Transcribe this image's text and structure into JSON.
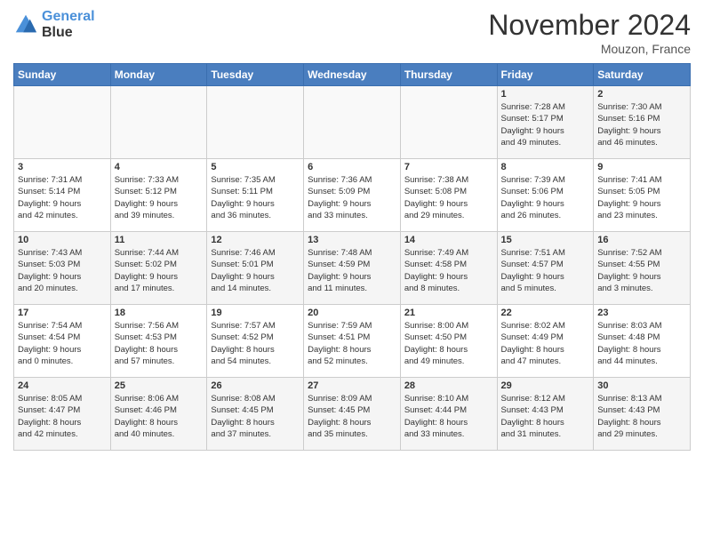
{
  "logo": {
    "line1": "General",
    "line2": "Blue"
  },
  "title": "November 2024",
  "location": "Mouzon, France",
  "days_header": [
    "Sunday",
    "Monday",
    "Tuesday",
    "Wednesday",
    "Thursday",
    "Friday",
    "Saturday"
  ],
  "weeks": [
    [
      {
        "day": "",
        "info": ""
      },
      {
        "day": "",
        "info": ""
      },
      {
        "day": "",
        "info": ""
      },
      {
        "day": "",
        "info": ""
      },
      {
        "day": "",
        "info": ""
      },
      {
        "day": "1",
        "info": "Sunrise: 7:28 AM\nSunset: 5:17 PM\nDaylight: 9 hours\nand 49 minutes."
      },
      {
        "day": "2",
        "info": "Sunrise: 7:30 AM\nSunset: 5:16 PM\nDaylight: 9 hours\nand 46 minutes."
      }
    ],
    [
      {
        "day": "3",
        "info": "Sunrise: 7:31 AM\nSunset: 5:14 PM\nDaylight: 9 hours\nand 42 minutes."
      },
      {
        "day": "4",
        "info": "Sunrise: 7:33 AM\nSunset: 5:12 PM\nDaylight: 9 hours\nand 39 minutes."
      },
      {
        "day": "5",
        "info": "Sunrise: 7:35 AM\nSunset: 5:11 PM\nDaylight: 9 hours\nand 36 minutes."
      },
      {
        "day": "6",
        "info": "Sunrise: 7:36 AM\nSunset: 5:09 PM\nDaylight: 9 hours\nand 33 minutes."
      },
      {
        "day": "7",
        "info": "Sunrise: 7:38 AM\nSunset: 5:08 PM\nDaylight: 9 hours\nand 29 minutes."
      },
      {
        "day": "8",
        "info": "Sunrise: 7:39 AM\nSunset: 5:06 PM\nDaylight: 9 hours\nand 26 minutes."
      },
      {
        "day": "9",
        "info": "Sunrise: 7:41 AM\nSunset: 5:05 PM\nDaylight: 9 hours\nand 23 minutes."
      }
    ],
    [
      {
        "day": "10",
        "info": "Sunrise: 7:43 AM\nSunset: 5:03 PM\nDaylight: 9 hours\nand 20 minutes."
      },
      {
        "day": "11",
        "info": "Sunrise: 7:44 AM\nSunset: 5:02 PM\nDaylight: 9 hours\nand 17 minutes."
      },
      {
        "day": "12",
        "info": "Sunrise: 7:46 AM\nSunset: 5:01 PM\nDaylight: 9 hours\nand 14 minutes."
      },
      {
        "day": "13",
        "info": "Sunrise: 7:48 AM\nSunset: 4:59 PM\nDaylight: 9 hours\nand 11 minutes."
      },
      {
        "day": "14",
        "info": "Sunrise: 7:49 AM\nSunset: 4:58 PM\nDaylight: 9 hours\nand 8 minutes."
      },
      {
        "day": "15",
        "info": "Sunrise: 7:51 AM\nSunset: 4:57 PM\nDaylight: 9 hours\nand 5 minutes."
      },
      {
        "day": "16",
        "info": "Sunrise: 7:52 AM\nSunset: 4:55 PM\nDaylight: 9 hours\nand 3 minutes."
      }
    ],
    [
      {
        "day": "17",
        "info": "Sunrise: 7:54 AM\nSunset: 4:54 PM\nDaylight: 9 hours\nand 0 minutes."
      },
      {
        "day": "18",
        "info": "Sunrise: 7:56 AM\nSunset: 4:53 PM\nDaylight: 8 hours\nand 57 minutes."
      },
      {
        "day": "19",
        "info": "Sunrise: 7:57 AM\nSunset: 4:52 PM\nDaylight: 8 hours\nand 54 minutes."
      },
      {
        "day": "20",
        "info": "Sunrise: 7:59 AM\nSunset: 4:51 PM\nDaylight: 8 hours\nand 52 minutes."
      },
      {
        "day": "21",
        "info": "Sunrise: 8:00 AM\nSunset: 4:50 PM\nDaylight: 8 hours\nand 49 minutes."
      },
      {
        "day": "22",
        "info": "Sunrise: 8:02 AM\nSunset: 4:49 PM\nDaylight: 8 hours\nand 47 minutes."
      },
      {
        "day": "23",
        "info": "Sunrise: 8:03 AM\nSunset: 4:48 PM\nDaylight: 8 hours\nand 44 minutes."
      }
    ],
    [
      {
        "day": "24",
        "info": "Sunrise: 8:05 AM\nSunset: 4:47 PM\nDaylight: 8 hours\nand 42 minutes."
      },
      {
        "day": "25",
        "info": "Sunrise: 8:06 AM\nSunset: 4:46 PM\nDaylight: 8 hours\nand 40 minutes."
      },
      {
        "day": "26",
        "info": "Sunrise: 8:08 AM\nSunset: 4:45 PM\nDaylight: 8 hours\nand 37 minutes."
      },
      {
        "day": "27",
        "info": "Sunrise: 8:09 AM\nSunset: 4:45 PM\nDaylight: 8 hours\nand 35 minutes."
      },
      {
        "day": "28",
        "info": "Sunrise: 8:10 AM\nSunset: 4:44 PM\nDaylight: 8 hours\nand 33 minutes."
      },
      {
        "day": "29",
        "info": "Sunrise: 8:12 AM\nSunset: 4:43 PM\nDaylight: 8 hours\nand 31 minutes."
      },
      {
        "day": "30",
        "info": "Sunrise: 8:13 AM\nSunset: 4:43 PM\nDaylight: 8 hours\nand 29 minutes."
      }
    ]
  ]
}
